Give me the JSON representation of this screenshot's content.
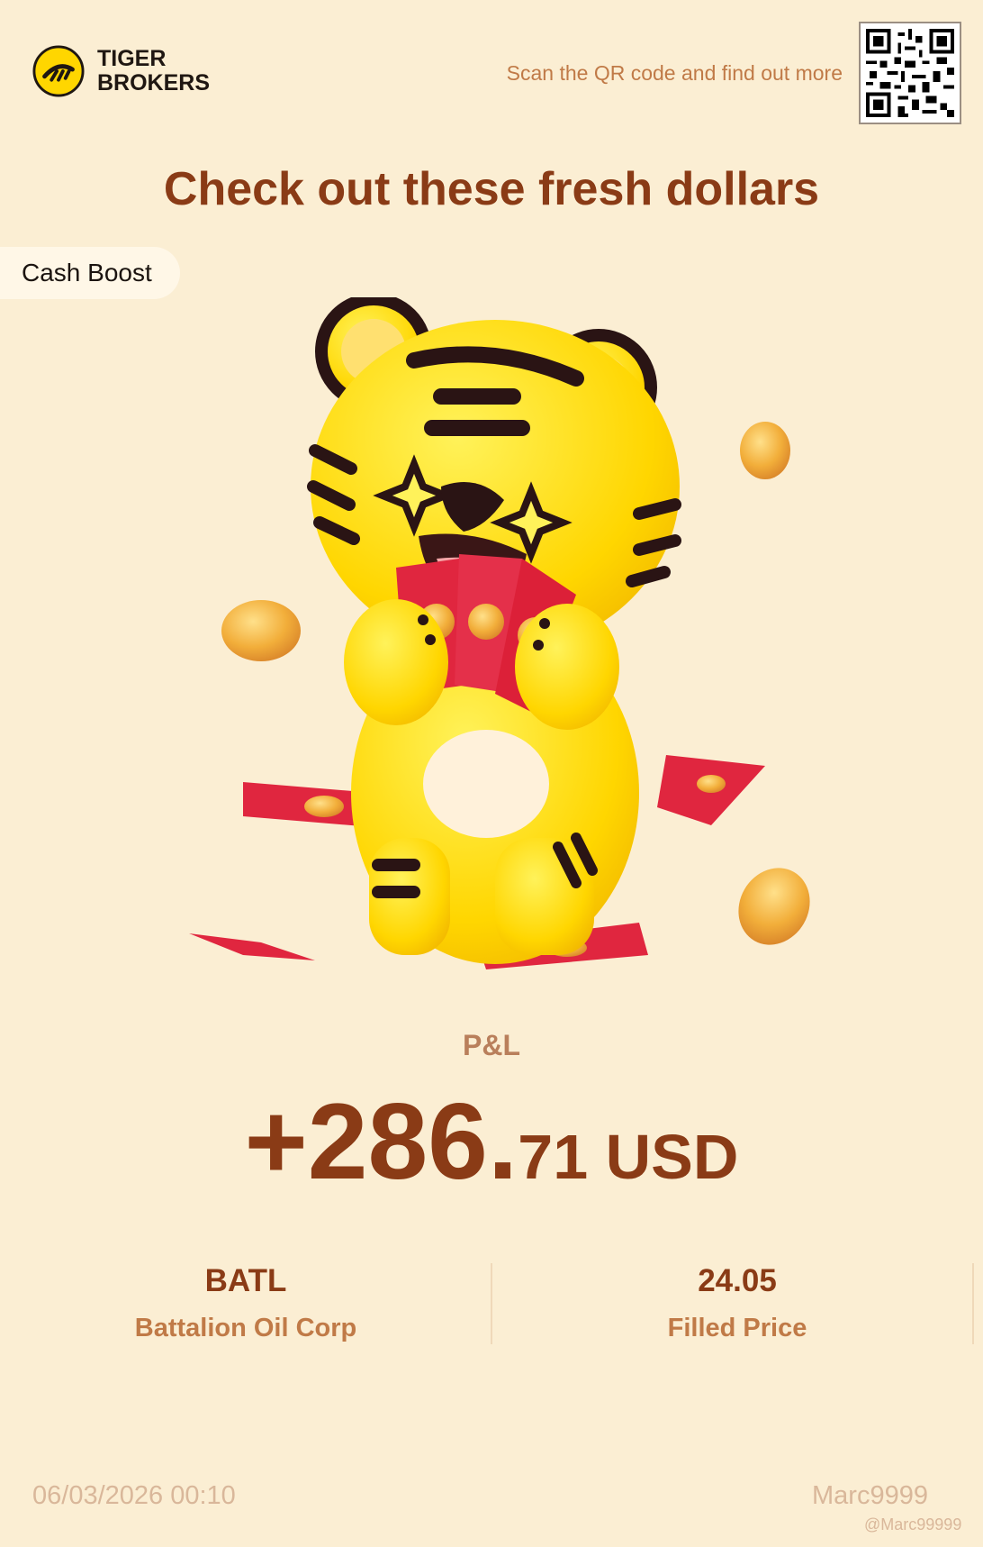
{
  "header": {
    "brand_line1": "TIGER",
    "brand_line2": "BROKERS",
    "scan_text": "Scan the QR code and find out more"
  },
  "headline": "Check out these fresh dollars",
  "badge": "Cash Boost",
  "pnl": {
    "label": "P&L",
    "amount_main": "+286.",
    "amount_cents": "71 USD"
  },
  "stats": [
    {
      "value": "BATL",
      "label": "Battalion Oil Corp"
    },
    {
      "value": "24.05",
      "label": "Filled Price"
    }
  ],
  "footer": {
    "timestamp": "06/03/2026 00:10",
    "username": "Marc9999",
    "watermark": "@Marc99999"
  },
  "colors": {
    "background": "#FBEED3",
    "accent": "#8A3B16",
    "muted": "#C07A47",
    "tiger_yellow": "#FFD600",
    "envelope_red": "#E0263F"
  }
}
